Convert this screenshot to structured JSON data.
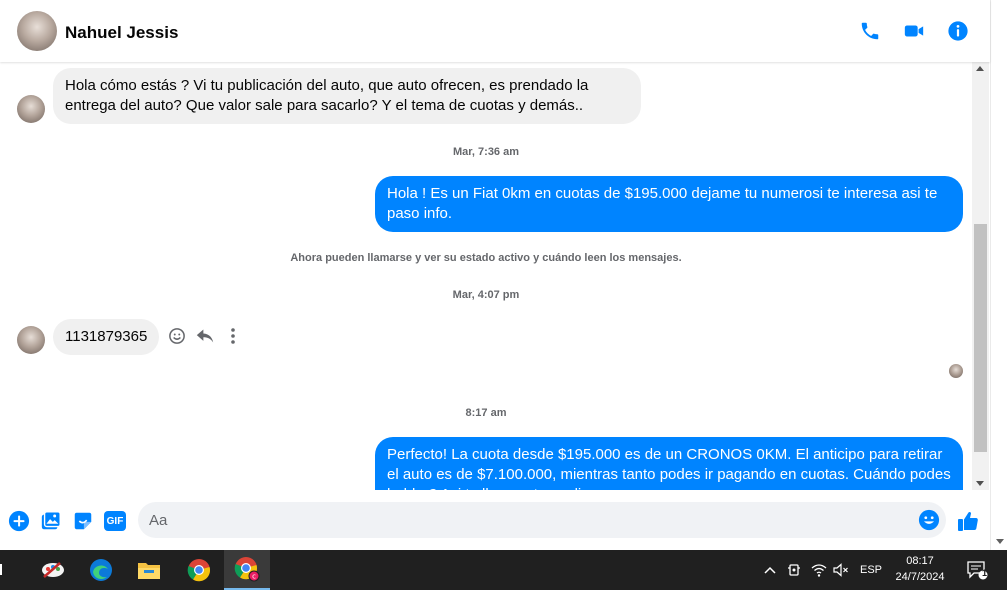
{
  "header": {
    "contact_name": "Nahuel Jessis",
    "icons": [
      "phone-icon",
      "video-camera-icon",
      "info-icon"
    ],
    "accent_color": "#0084ff"
  },
  "chat": {
    "messages": [
      {
        "direction": "incoming",
        "text": "Hola cómo estás ? Vi tu publicación del auto, que auto ofrecen, es prendado la entrega del auto? Que valor sale para sacarlo? Y el tema de cuotas y demás.."
      },
      {
        "type": "timestamp",
        "text": "Mar, 7:36 am"
      },
      {
        "direction": "outgoing",
        "text": "Hola ! Es un Fiat 0km en cuotas de $195.000 dejame tu numerosi te interesa  asi te paso info."
      },
      {
        "type": "system",
        "text": "Ahora pueden llamarse y ver su estado activo y cuándo leen los mensajes."
      },
      {
        "type": "timestamp",
        "text": "Mar, 4:07 pm"
      },
      {
        "direction": "incoming",
        "text": "1131879365"
      },
      {
        "type": "timestamp",
        "text": "8:17 am"
      },
      {
        "direction": "outgoing",
        "text": "Perfecto! La cuota desde $195.000 es de un CRONOS 0KM. El anticipo para retirar el auto es de $7.100.000, mientras tanto podes ir pagando en cuotas. Cuándo podes hablar? Asi te llamo y te explico"
      }
    ],
    "incoming_bubble_color": "#f0f0f0",
    "outgoing_bubble_color": "#0084ff"
  },
  "composer": {
    "placeholder": "Aa",
    "gif_label": "GIF",
    "icons": [
      "plus-icon",
      "gallery-icon",
      "sticker-icon",
      "gif-icon",
      "emoji-icon",
      "like-icon"
    ]
  },
  "taskbar": {
    "language": "ESP",
    "time": "08:17",
    "date": "24/7/2024",
    "notification_count": "1"
  }
}
